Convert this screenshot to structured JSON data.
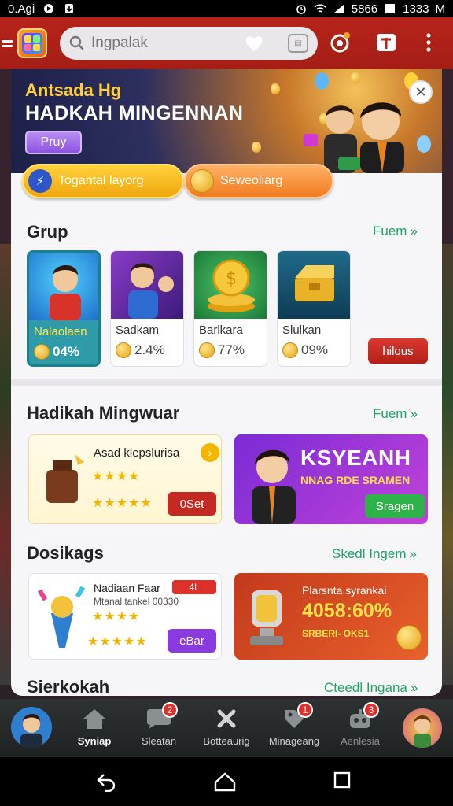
{
  "status_bar": {
    "left_text": "0.Agi",
    "right_text": "5866",
    "time": "1333",
    "extra": "M"
  },
  "search": {
    "placeholder": "Ingpalak"
  },
  "banner": {
    "line1": "Antsada Hg",
    "line2": "HADKAH MINGENNAN",
    "button": "Pruy"
  },
  "pills": [
    {
      "label": "Togantal layorg",
      "color": "#f0a60d"
    },
    {
      "label": "Seweoliarg",
      "color": "#f07b1f"
    }
  ],
  "section_grup": {
    "title": "Grup",
    "more": "Fuem",
    "tiles": [
      {
        "name": "Nalaolaen",
        "value": "04%"
      },
      {
        "name": "Sadkam",
        "value": "2.4%"
      },
      {
        "name": "Barlkara",
        "value": "77%"
      },
      {
        "name": "Slulkan",
        "value": "09%"
      }
    ],
    "action": "hilous"
  },
  "section_hadikah": {
    "title": "Hadikah Mingwuar",
    "more": "Fuem",
    "card1": {
      "title": "Asad klepslurisa",
      "button": "0Set"
    },
    "card2": {
      "headline": "KSYEANH",
      "sub": "NNAG RDE SRAMEN",
      "button": "Sragen"
    }
  },
  "section_dosikags": {
    "title": "Dosikags",
    "more": "Skedl Ingem",
    "card1": {
      "title": "Nadiaan Faar",
      "subtitle": "Mtanal tankel 00330",
      "tag": "4L",
      "button": "eBar"
    },
    "card2": {
      "title": "Plarsnta syrankai",
      "value": "4058:60%",
      "sub": "SRBERI- OKS1"
    }
  },
  "section_sierkokah": {
    "title": "Sierkokah",
    "more": "Cteedl Ingana"
  },
  "bottom_nav": [
    {
      "label": "Syniap",
      "badge": ""
    },
    {
      "label": "Sleatan",
      "badge": "2"
    },
    {
      "label": "Botteaurig",
      "badge": ""
    },
    {
      "label": "Minageang",
      "badge": "1"
    },
    {
      "label": "Aenlesia",
      "badge": "3"
    }
  ],
  "colors": {
    "brand_red": "#b7231a",
    "accent_green": "#1fa36b",
    "purple": "#8a53e0"
  }
}
